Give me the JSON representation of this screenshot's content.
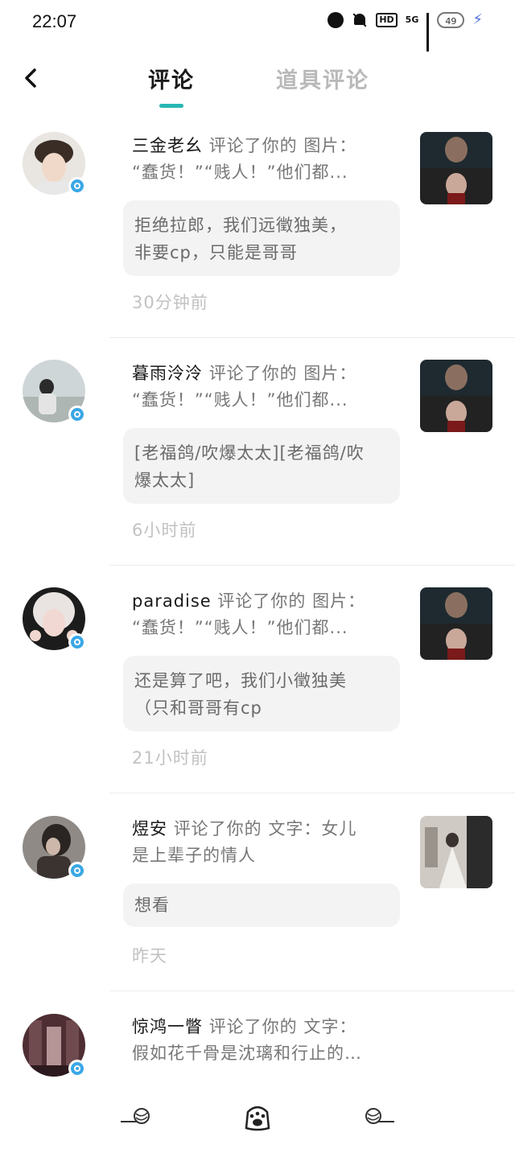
{
  "status_bar": {
    "time": "22:07",
    "network": "5G",
    "hd": "HD",
    "battery": "49"
  },
  "header": {
    "tabs": [
      {
        "label": "评论",
        "active": true
      },
      {
        "label": "道具评论",
        "active": false
      }
    ],
    "accent_color": "#27b8b4"
  },
  "notifications": [
    {
      "username": "三金老幺",
      "action": "评论了你的",
      "target_type": "图片：",
      "target_preview": "“蠢货！”“贱人！”他们都...",
      "reply": "拒绝拉郎，我们远徵独美，非要cp，只能是哥哥",
      "reply_lines": [
        "拒绝拉郎，我们远徵独美，",
        "非要cp，只能是哥哥"
      ],
      "time": "30分钟前"
    },
    {
      "username": "暮雨泠泠",
      "action": "评论了你的",
      "target_type": "图片：",
      "target_preview": "“蠢货！”“贱人！”他们都...",
      "reply": "[老福鸽/吹爆太太][老福鸽/吹爆太太]",
      "reply_lines": [
        "[老福鸽/吹爆太太][老福鸽/吹",
        "爆太太]"
      ],
      "time": "6小时前"
    },
    {
      "username": "paradise",
      "action": "评论了你的",
      "target_type": "图片：",
      "target_preview": "“蠢货！”“贱人！”他们都...",
      "reply": "还是算了吧，我们小徵独美（只和哥哥有cp",
      "reply_lines": [
        "还是算了吧，我们小徵独美",
        "（只和哥哥有cp"
      ],
      "time": "21小时前"
    },
    {
      "username": "煜安",
      "action": "评论了你的",
      "target_type": "文字：",
      "target_preview_line1": "女儿",
      "target_preview_line2": "是上辈子的情人",
      "reply": "想看",
      "time": "昨天"
    },
    {
      "username": "惊鸿一瞥",
      "action": "评论了你的",
      "target_type": "文字：",
      "target_preview": "假如花千骨是沈璃和行止的…"
    }
  ]
}
